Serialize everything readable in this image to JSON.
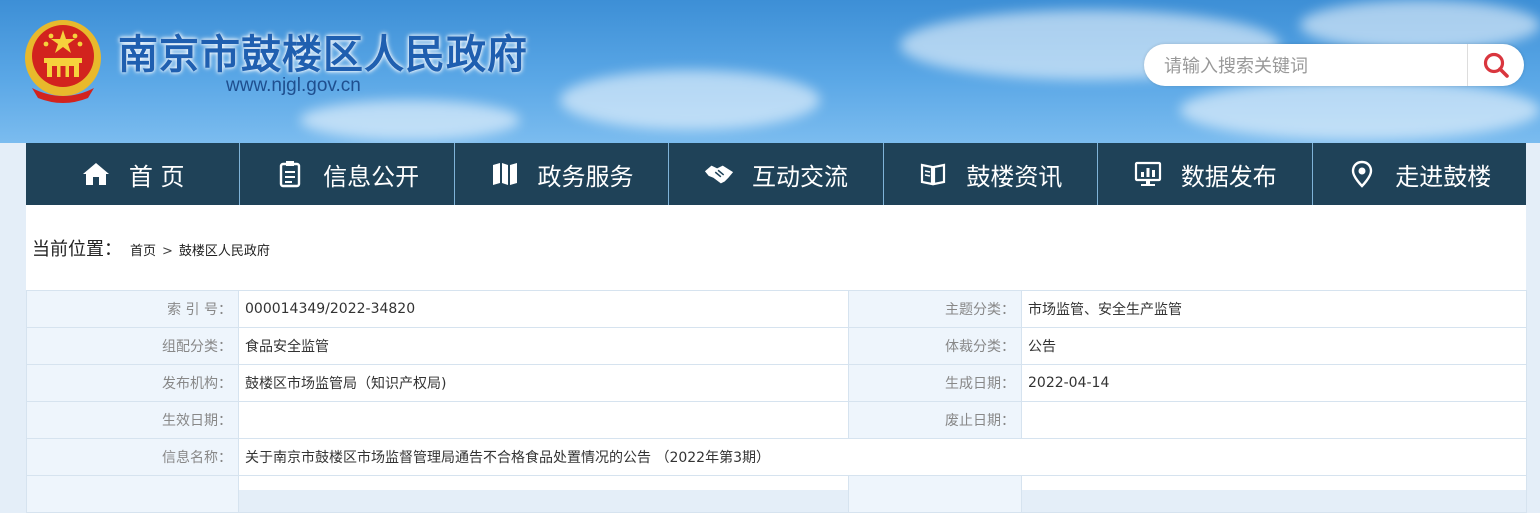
{
  "header": {
    "site_title": "南京市鼓楼区人民政府",
    "site_url": "www.njgl.gov.cn",
    "search_placeholder": "请输入搜索关键词"
  },
  "nav": {
    "items": [
      {
        "label": "首 页",
        "icon": "home-icon"
      },
      {
        "label": "信息公开",
        "icon": "clipboard-icon"
      },
      {
        "label": "政务服务",
        "icon": "map-icon"
      },
      {
        "label": "互动交流",
        "icon": "handshake-icon"
      },
      {
        "label": "鼓楼资讯",
        "icon": "book-icon"
      },
      {
        "label": "数据发布",
        "icon": "monitor-chart-icon"
      },
      {
        "label": "走进鼓楼",
        "icon": "location-pin-icon"
      }
    ]
  },
  "breadcrumb": {
    "label": "当前位置：",
    "home": "首页",
    "separator": ">",
    "current": "鼓楼区人民政府"
  },
  "meta": {
    "index_label": "索 引 号：",
    "index_value": "000014349/2022-34820",
    "topic_label": "主题分类：",
    "topic_value": "市场监管、安全生产监管",
    "category_label": "组配分类：",
    "category_value": "食品安全监管",
    "genre_label": "体裁分类：",
    "genre_value": "公告",
    "publisher_label": "发布机构：",
    "publisher_value": "鼓楼区市场监管局（知识产权局)",
    "created_label": "生成日期：",
    "created_value": "2022-04-14",
    "effective_label": "生效日期：",
    "effective_value": "",
    "abolished_label": "废止日期：",
    "abolished_value": "",
    "name_label": "信息名称：",
    "name_value": "关于南京市鼓楼区市场监督管理局通告不合格食品处置情况的公告 （2022年第3期）"
  },
  "colors": {
    "nav_bg": "#1f4258",
    "title_blue": "#1f5fb0",
    "label_bg": "#eef5fc",
    "search_icon": "#d9363e"
  }
}
